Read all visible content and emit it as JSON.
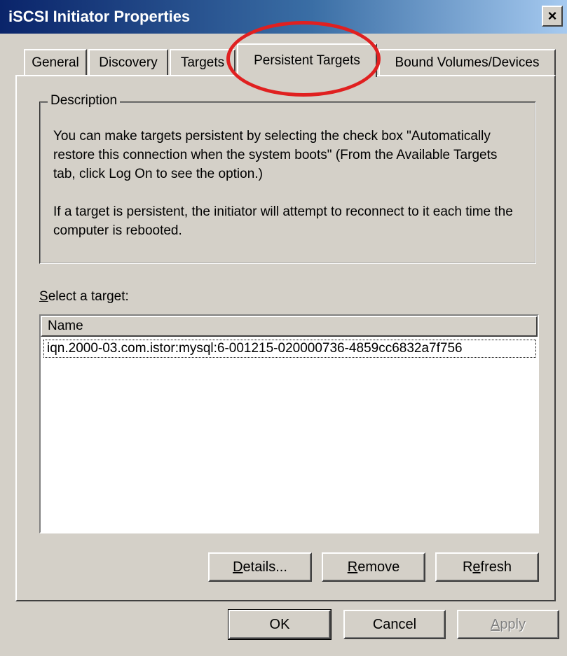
{
  "window": {
    "title": "iSCSI Initiator Properties",
    "close_glyph": "×"
  },
  "tabs": [
    {
      "label": "General"
    },
    {
      "label": "Discovery"
    },
    {
      "label": "Targets"
    },
    {
      "label": "Persistent Targets",
      "active": true
    },
    {
      "label": "Bound Volumes/Devices"
    }
  ],
  "description": {
    "legend": "Description",
    "paragraph1": "You can make targets persistent by selecting the check box \"Automatically restore this connection when the system boots\" (From the Available Targets tab, click Log On to see the option.)",
    "paragraph2": "If a target is persistent, the initiator will attempt to reconnect to it each time the computer is rebooted."
  },
  "target_list": {
    "label_accel": "S",
    "label_rest": "elect a target:",
    "column_header": "Name",
    "items": [
      "iqn.2000-03.com.istor:mysql:6-001215-020000736-4859cc6832a7f756"
    ]
  },
  "panel_buttons": {
    "details": {
      "accel": "D",
      "rest": "etails..."
    },
    "remove": {
      "accel": "R",
      "rest": "emove"
    },
    "refresh": {
      "pre": "R",
      "accel": "e",
      "rest": "fresh"
    }
  },
  "dialog_buttons": {
    "ok": "OK",
    "cancel": "Cancel",
    "apply": {
      "accel": "A",
      "rest": "pply"
    }
  },
  "colors": {
    "dialog_face": "#d4d0c8",
    "title_gradient_start": "#0a246a",
    "annotation_circle": "#e02020"
  }
}
